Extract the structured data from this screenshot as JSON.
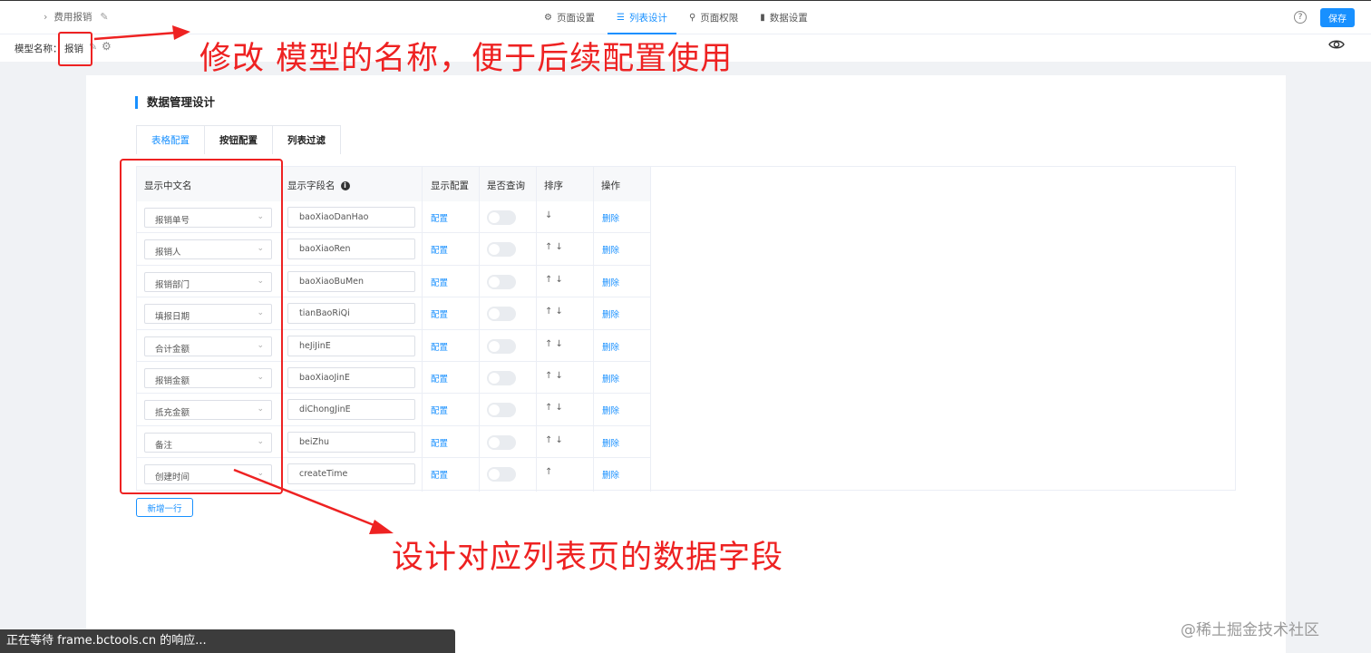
{
  "header": {
    "breadcrumb": "费用报销",
    "tabs": [
      {
        "label": "页面设置",
        "icon": "gear-icon"
      },
      {
        "label": "列表设计",
        "icon": "list-icon",
        "active": true
      },
      {
        "label": "页面权限",
        "icon": "lock-icon"
      },
      {
        "label": "数据设置",
        "icon": "bar-chart-icon"
      }
    ],
    "help": "?",
    "save_label": "保存"
  },
  "model": {
    "label": "模型名称：",
    "value": "报销"
  },
  "card": {
    "title": "数据管理设计",
    "tabs": [
      "表格配置",
      "按钮配置",
      "列表过滤"
    ],
    "active_tab": 0
  },
  "table": {
    "columns": [
      "显示中文名",
      "显示字段名",
      "显示配置",
      "是否查询",
      "排序",
      "操作"
    ],
    "rows": [
      {
        "name": "报销单号",
        "field": "baoXiaoDanHao",
        "config": "配置",
        "sort": "↓",
        "action": "删除"
      },
      {
        "name": "报销人",
        "field": "baoXiaoRen",
        "config": "配置",
        "sort": "↑ ↓",
        "action": "删除"
      },
      {
        "name": "报销部门",
        "field": "baoXiaoBuMen",
        "config": "配置",
        "sort": "↑ ↓",
        "action": "删除"
      },
      {
        "name": "填报日期",
        "field": "tianBaoRiQi",
        "config": "配置",
        "sort": "↑ ↓",
        "action": "删除"
      },
      {
        "name": "合计金额",
        "field": "heJiJinE",
        "config": "配置",
        "sort": "↑ ↓",
        "action": "删除"
      },
      {
        "name": "报销金额",
        "field": "baoXiaoJinE",
        "config": "配置",
        "sort": "↑ ↓",
        "action": "删除"
      },
      {
        "name": "抵充金额",
        "field": "diChongJinE",
        "config": "配置",
        "sort": "↑ ↓",
        "action": "删除"
      },
      {
        "name": "备注",
        "field": "beiZhu",
        "config": "配置",
        "sort": "↑ ↓",
        "action": "删除"
      },
      {
        "name": "创建时间",
        "field": "createTime",
        "config": "配置",
        "sort": "↑",
        "action": "删除"
      }
    ],
    "add_row_label": "新增一行"
  },
  "annotations": {
    "top": "修改 模型的名称，便于后续配置使用",
    "bottom": "设计对应列表页的数据字段",
    "color": "#ee2222"
  },
  "status_bar": "正在等待 frame.bctools.cn 的响应...",
  "watermark": "@稀土掘金技术社区",
  "colors": {
    "accent": "#1890ff",
    "annotation": "#ee2222"
  }
}
